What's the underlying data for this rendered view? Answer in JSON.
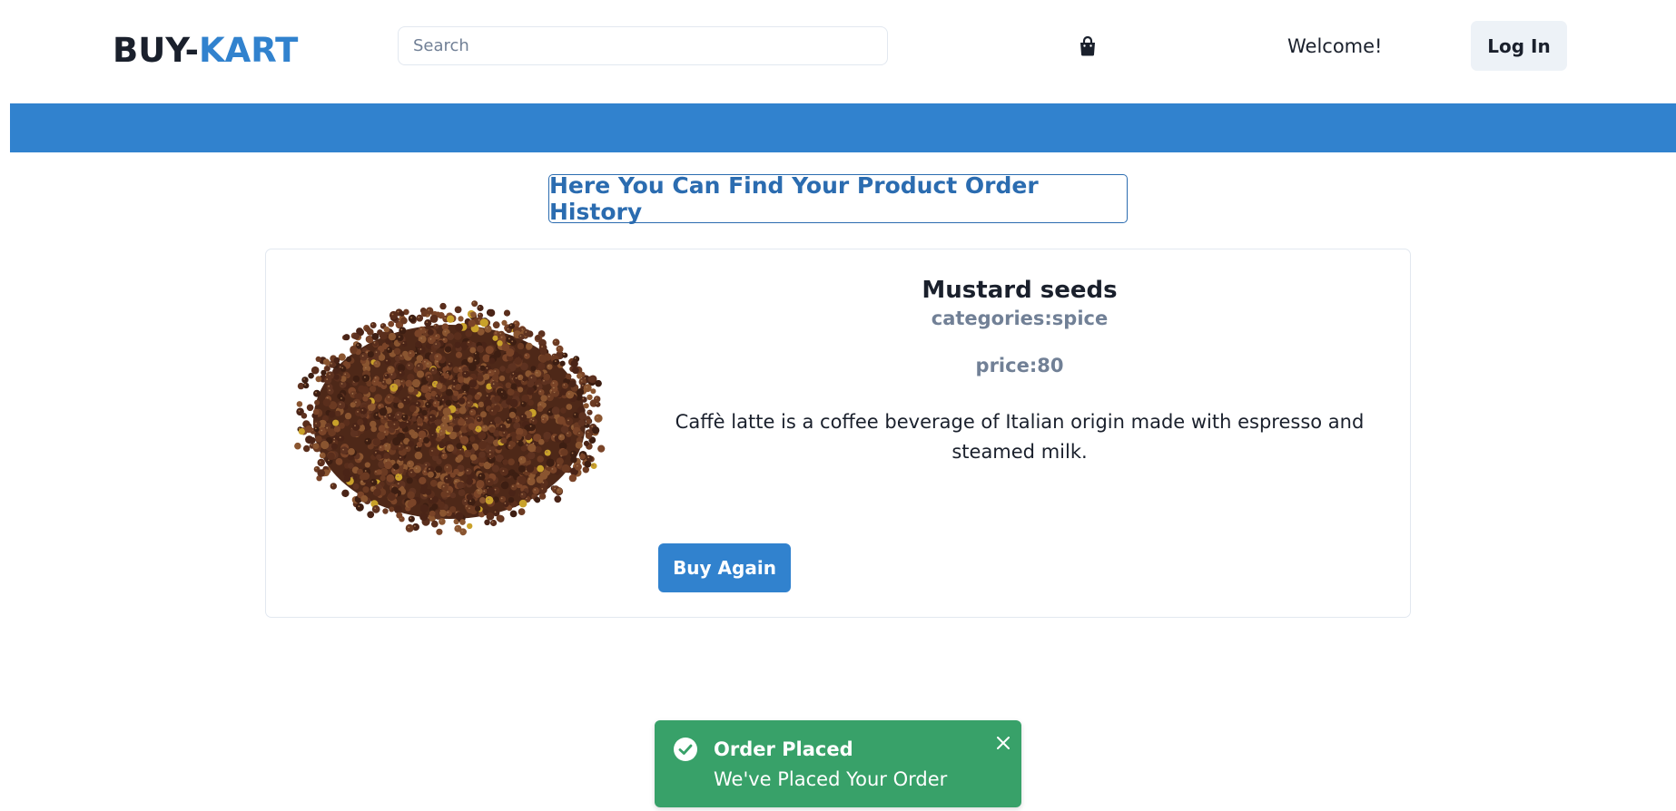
{
  "header": {
    "logo_part1": "BUY-",
    "logo_part2": "KART",
    "search_placeholder": "Search",
    "cart_icon": "shopping-bag-icon",
    "welcome_text": "Welcome!",
    "login_label": "Log In"
  },
  "banner": {
    "color": "#3182ce"
  },
  "page_heading": "Here You Can Find Your Product Order History",
  "orders": [
    {
      "name": "Mustard seeds",
      "category_text": "categories:spice",
      "price_text": "price:80",
      "description": "Caffè latte is a coffee beverage of Italian origin made with espresso and steamed milk.",
      "button_label": "Buy Again",
      "image_alt": "mustard seeds pile"
    }
  ],
  "toast": {
    "icon": "check-circle-icon",
    "title": "Order Placed",
    "message": "We've Placed Your Order",
    "close_icon": "close-icon",
    "color": "#38a169"
  },
  "colors": {
    "accent": "#3182ce",
    "heading": "#2b6cb0",
    "muted": "#718096",
    "text": "#1a202c",
    "success": "#38a169"
  }
}
